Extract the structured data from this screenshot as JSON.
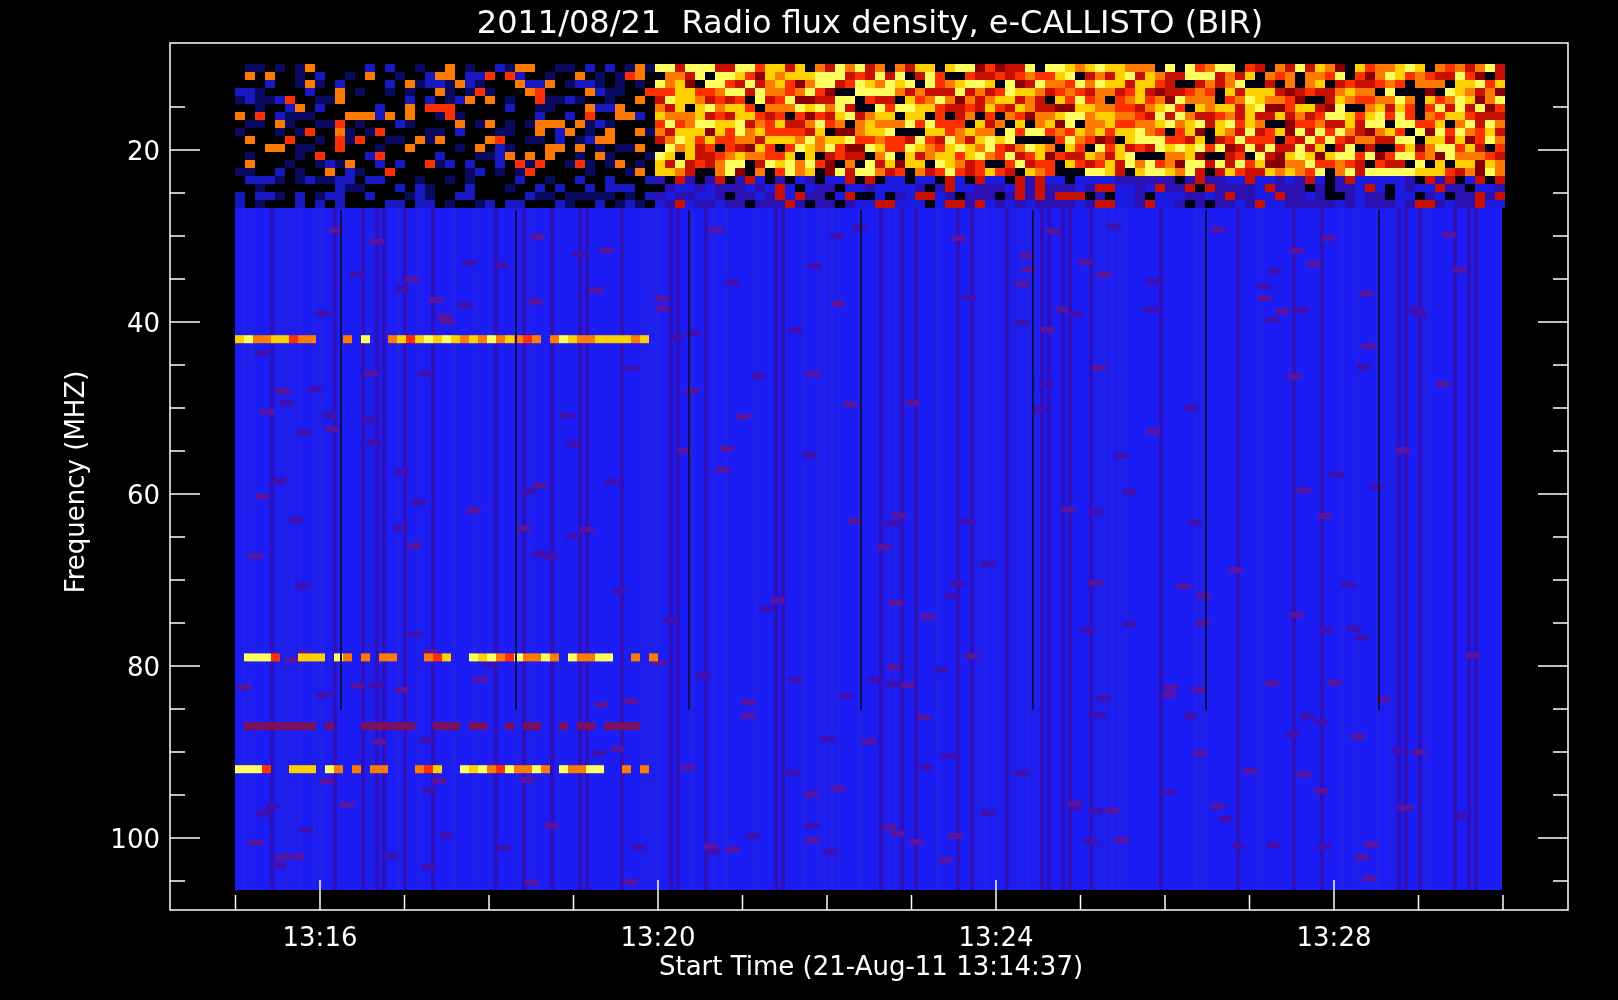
{
  "title": "2011/08/21  Radio flux density, e-CALLISTO (BIR)",
  "y_axis": {
    "label": "Frequency (MHZ)",
    "ticks": [
      "20",
      "40",
      "60",
      "80",
      "100"
    ]
  },
  "x_axis": {
    "label": "Start Time (21-Aug-11 13:14:37)",
    "ticks": [
      "13:16",
      "13:20",
      "13:24",
      "13:28"
    ]
  }
}
